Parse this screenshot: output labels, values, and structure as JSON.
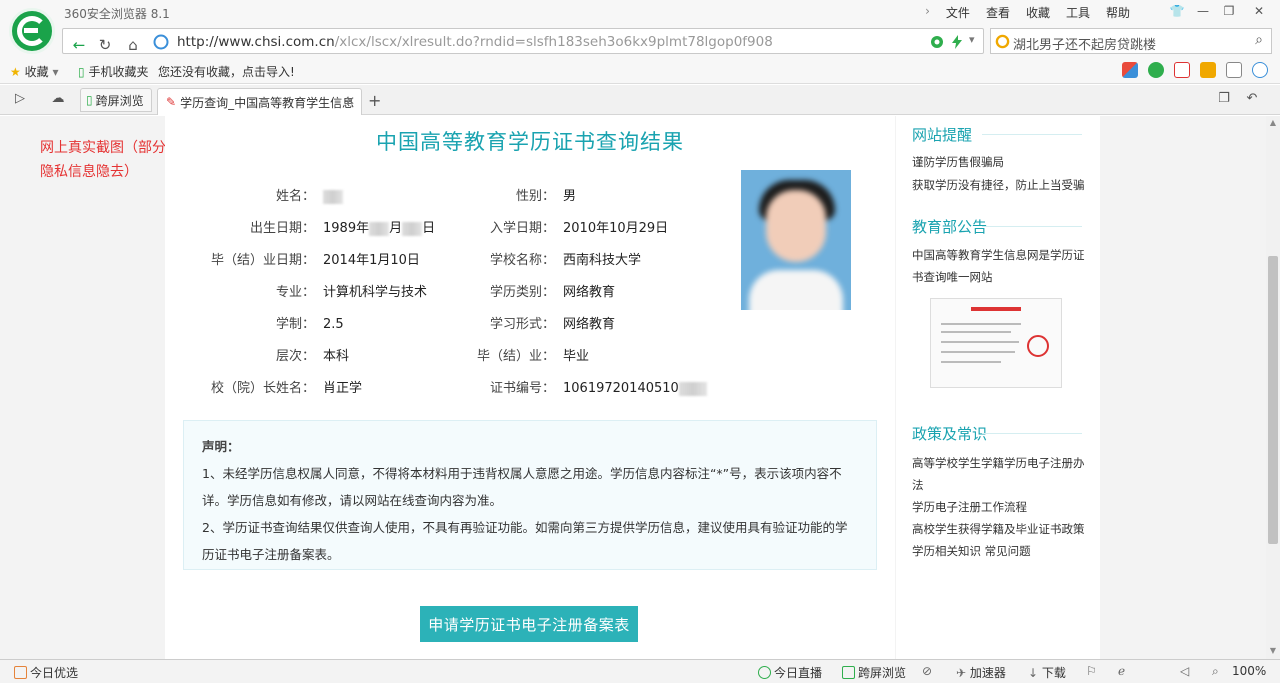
{
  "browser": {
    "app_title": "360安全浏览器 8.1",
    "menu": [
      "文件",
      "查看",
      "收藏",
      "工具",
      "帮助"
    ],
    "url_domain": "http://www.chsi.com.cn",
    "url_path": "/xlcx/lscx/xlresult.do?rndid=slsfh183seh3o6kx9plmt78lgop0f908",
    "search_text": "湖北男子还不起房贷跳楼"
  },
  "favorites": {
    "label": "收藏",
    "mobile": "手机收藏夹",
    "hint": "您还没有收藏，点击导入!"
  },
  "tabs": {
    "pinned": "跨屏浏览",
    "active": "学历查询_中国高等教育学生信息"
  },
  "note": "网上真实截图（部分隐私信息隐去）",
  "result": {
    "title": "中国高等教育学历证书查询结果",
    "left_fields": [
      {
        "label": "姓名：",
        "value": ""
      },
      {
        "label": "出生日期：",
        "value": "1989年"
      },
      {
        "label": "毕（结）业日期：",
        "value": "2014年1月10日"
      },
      {
        "label": "专业：",
        "value": "计算机科学与技术"
      },
      {
        "label": "学制：",
        "value": "2.5"
      },
      {
        "label": "层次：",
        "value": "本科"
      },
      {
        "label": "校（院）长姓名：",
        "value": "肖正学"
      }
    ],
    "birth_mid": "月",
    "birth_end": "日",
    "right_fields": [
      {
        "label": "性别：",
        "value": "男"
      },
      {
        "label": "入学日期：",
        "value": "2010年10月29日"
      },
      {
        "label": "学校名称：",
        "value": "西南科技大学"
      },
      {
        "label": "学历类别：",
        "value": "网络教育"
      },
      {
        "label": "学习形式：",
        "value": "网络教育"
      },
      {
        "label": "毕（结）业：",
        "value": "毕业"
      },
      {
        "label": "证书编号：",
        "value": "10619720140510"
      }
    ]
  },
  "declaration": {
    "heading": "声明：",
    "p1": "1、未经学历信息权属人同意，不得将本材料用于违背权属人意愿之用途。学历信息内容标注“*”号，表示该项内容不详。学历信息如有修改，请以网站在线查询内容为准。",
    "p2": "2、学历证书查询结果仅供查询人使用，不具有再验证功能。如需向第三方提供学历信息，建议使用具有验证功能的学历证书电子注册备案表。"
  },
  "apply_button": "申请学历证书电子注册备案表",
  "sidebar": {
    "sec1_title": "网站提醒",
    "sec1_links": [
      "谨防学历售假骗局",
      "获取学历没有捷径，防止上当受骗"
    ],
    "sec2_title": "教育部公告",
    "sec2_text": [
      "中国高等教育学生信息网是学历证",
      "书查询唯一网站"
    ],
    "sec3_title": "政策及常识",
    "sec3_links": [
      "高等学校学生学籍学历电子注册办",
      "法",
      "学历电子注册工作流程",
      "高校学生获得学籍及毕业证书政策",
      "学历相关知识    常见问题"
    ]
  },
  "status": {
    "left": "今日优选",
    "live": "今日直播",
    "cross": "跨屏浏览",
    "accel": "加速器",
    "download": "下载",
    "zoom": "100%"
  }
}
